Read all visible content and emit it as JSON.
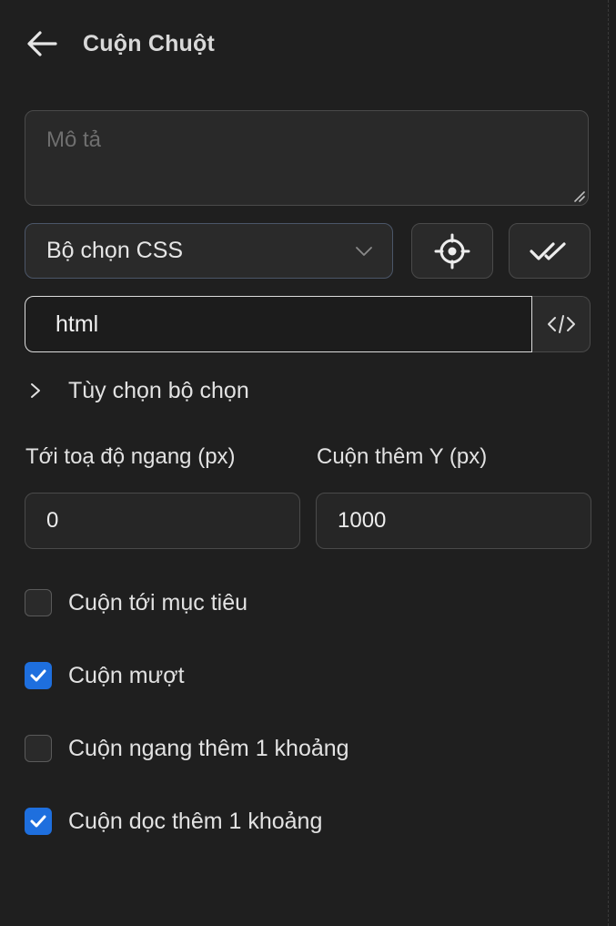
{
  "header": {
    "title": "Cuộn Chuột"
  },
  "description": {
    "placeholder": "Mô tả",
    "value": ""
  },
  "selector": {
    "type_selected": "Bộ chọn CSS",
    "value": "html"
  },
  "selector_options": {
    "label": "Tùy chọn bộ chọn",
    "expanded": false
  },
  "fields": {
    "x": {
      "label": "Tới toạ độ ngang (px)",
      "value": "0"
    },
    "y": {
      "label": "Cuộn thêm Y (px)",
      "value": "1000"
    }
  },
  "checkboxes": [
    {
      "label": "Cuộn tới mục tiêu",
      "checked": false
    },
    {
      "label": "Cuộn mượt",
      "checked": true
    },
    {
      "label": "Cuộn ngang thêm 1 khoảng",
      "checked": false
    },
    {
      "label": "Cuộn dọc thêm 1 khoảng",
      "checked": true
    }
  ],
  "colors": {
    "background": "#1f1f1f",
    "accent": "#1e6fde"
  },
  "icons": [
    "back-arrow-icon",
    "chevron-down-icon",
    "crosshair-icon",
    "double-check-icon",
    "code-icon",
    "chevron-right-icon",
    "check-icon"
  ]
}
